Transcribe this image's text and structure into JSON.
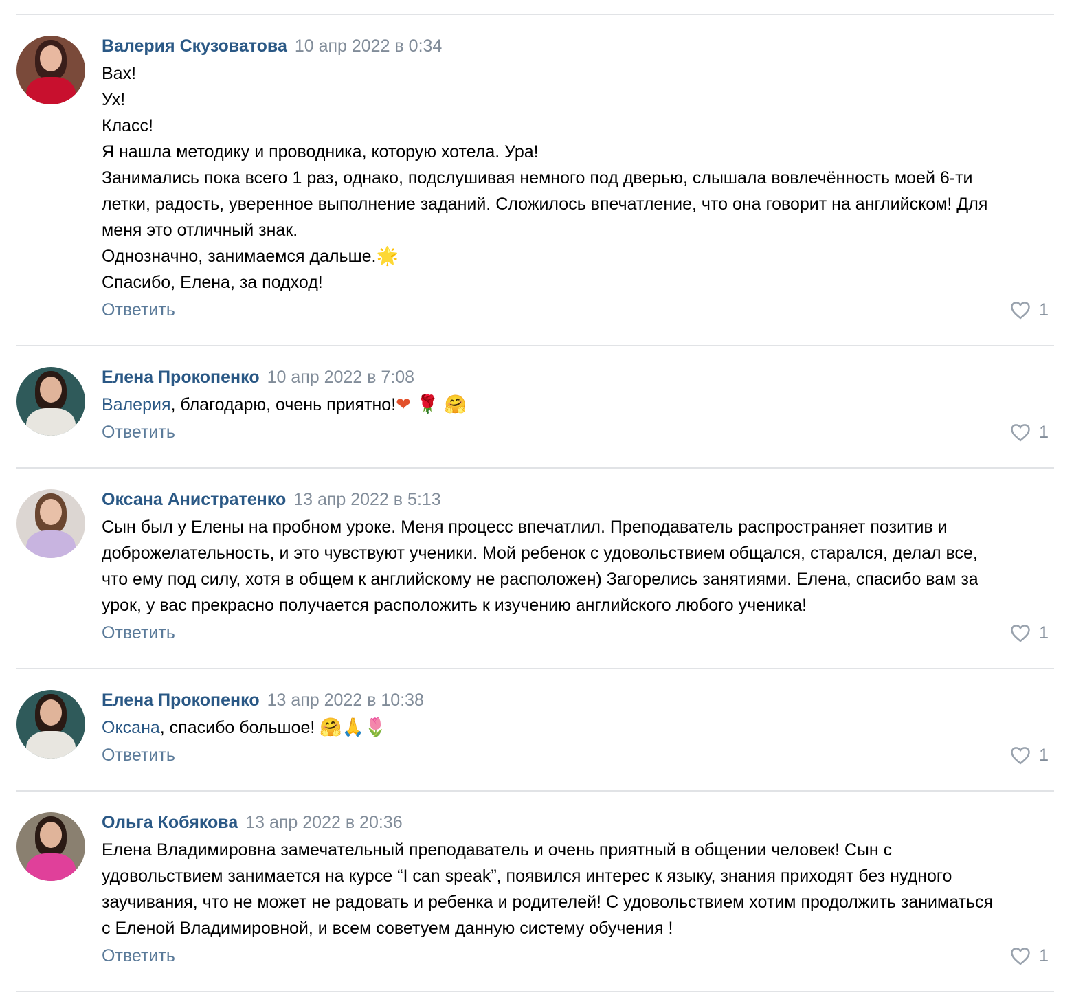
{
  "reply_label": "Ответить",
  "colors": {
    "author": "#2a5885",
    "date": "#818c99",
    "reply": "#5a7a99",
    "divider": "#e1e3e6"
  },
  "comments": [
    {
      "author": "Валерия Скузоватова",
      "date": "10 апр 2022 в 0:34",
      "lines": [
        "Вах!",
        "Ух!",
        "Класс!",
        "Я нашла методику и проводника, которую хотела. Ура!",
        "Занимались пока всего 1 раз, однако, подслушивая немного под дверью, слышала вовлечённость моей 6-ти",
        "летки, радость, уверенное выполнение заданий. Сложилось впечатление, что она говорит на английском! Для",
        "меня это отличный знак.",
        "Однозначно, занимаемся дальше.",
        "Спасибо, Елена, за подход!"
      ],
      "emoji_after_line_8": "🌟",
      "likes": "1",
      "avatar": {
        "bg": "#7a4a3a",
        "hair": "#3a1e1a",
        "face": "#e8b8a0",
        "body": "#c8102e"
      }
    },
    {
      "author": "Елена Прокопенко",
      "date": "10 апр 2022 в 7:08",
      "mention": "Валерия",
      "text": ", благодарю, очень приятно!",
      "emojis": "❤ 🌹 🤗",
      "likes": "1",
      "avatar": {
        "bg": "#2f5a5a",
        "hair": "#2a1a14",
        "face": "#e0b49a",
        "body": "#e8e6e0"
      }
    },
    {
      "author": "Оксана Анистратенко",
      "date": "13 апр 2022 в 5:13",
      "lines": [
        "Сын был у Елены на пробном уроке. Меня процесс впечатлил. Преподаватель распространяет позитив и",
        "доброжелательность, и это чувствуют ученики. Мой ребенок с удовольствием общался, старался, делал все,",
        "что ему под силу, хотя в общем к английскому не расположен) Загорелись занятиями. Елена, спасибо вам за",
        "урок, у вас прекрасно получается расположить к изучению английского любого ученика!"
      ],
      "likes": "1",
      "avatar": {
        "bg": "#dcd6d2",
        "hair": "#6a4630",
        "face": "#e8c0a8",
        "body": "#c8b4e0"
      }
    },
    {
      "author": "Елена Прокопенко",
      "date": "13 апр 2022 в 10:38",
      "mention": "Оксана",
      "text": ", спасибо большое! ",
      "emojis": "🤗🙏🌷",
      "likes": "1",
      "avatar": {
        "bg": "#2f5a5a",
        "hair": "#2a1a14",
        "face": "#e0b49a",
        "body": "#e8e6e0"
      }
    },
    {
      "author": "Ольга Кобякова",
      "date": "13 апр 2022 в 20:36",
      "lines": [
        "Елена Владимировна замечательный преподаватель и очень приятный в общении человек! Сын с",
        "удовольствием занимается на курсе “I can speak”, появился интерес к языку, знания приходят без нудного",
        "заучивания, что не может не радовать и ребенка и родителей! С удовольствием хотим продолжить заниматься",
        "с Еленой Владимировной, и всем советуем данную систему обучения !"
      ],
      "likes": "1",
      "avatar": {
        "bg": "#8a8070",
        "hair": "#2a1a14",
        "face": "#e0b49a",
        "body": "#e0409a"
      }
    }
  ]
}
